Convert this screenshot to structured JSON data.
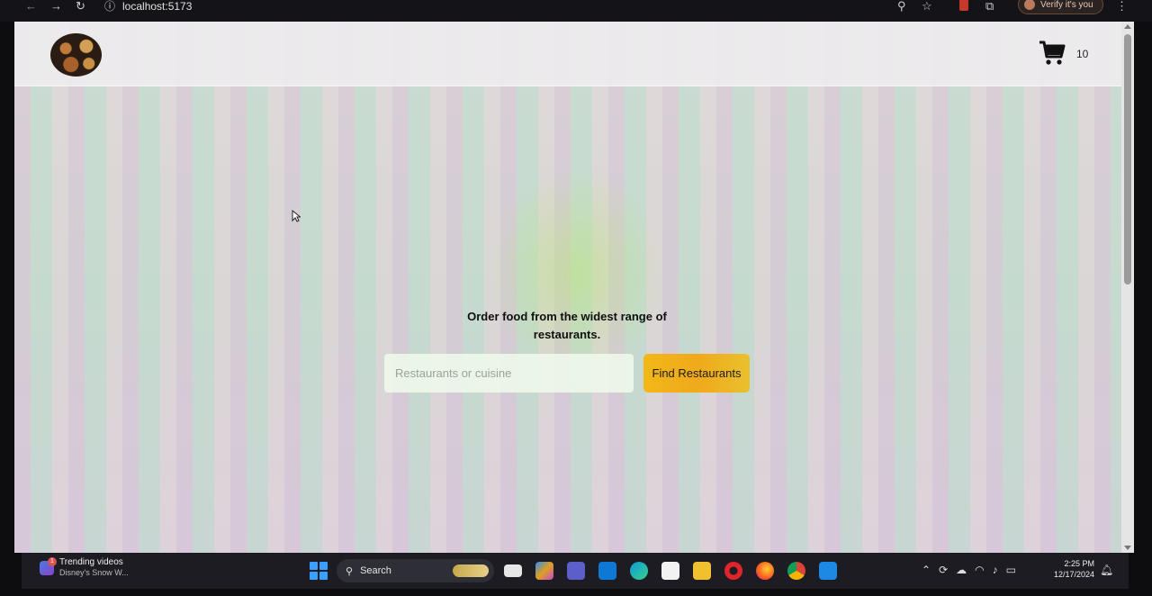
{
  "browser": {
    "url": "localhost:5173",
    "verify_label": "Verify it's you"
  },
  "header": {
    "cart_count": "10"
  },
  "hero": {
    "heading": "Order food from the widest range of restaurants.",
    "search_placeholder": "Restaurants or cuisine",
    "find_button_label": "Find Restaurants"
  },
  "taskbar": {
    "news_title": "Trending videos",
    "news_subtitle": "Disney's Snow W...",
    "news_badge": "1",
    "search_label": "Search",
    "time": "2:25 PM",
    "date": "12/17/2024",
    "apps": [
      "file-explorer-icon",
      "copilot-icon",
      "teams-icon",
      "outlook-icon",
      "edge-icon",
      "store-icon",
      "folder-icon",
      "opera-icon",
      "firefox-icon",
      "chrome-icon",
      "vscode-icon"
    ]
  },
  "colors": {
    "accent_button": "#f2b818",
    "taskbar": "#1c1c22"
  }
}
